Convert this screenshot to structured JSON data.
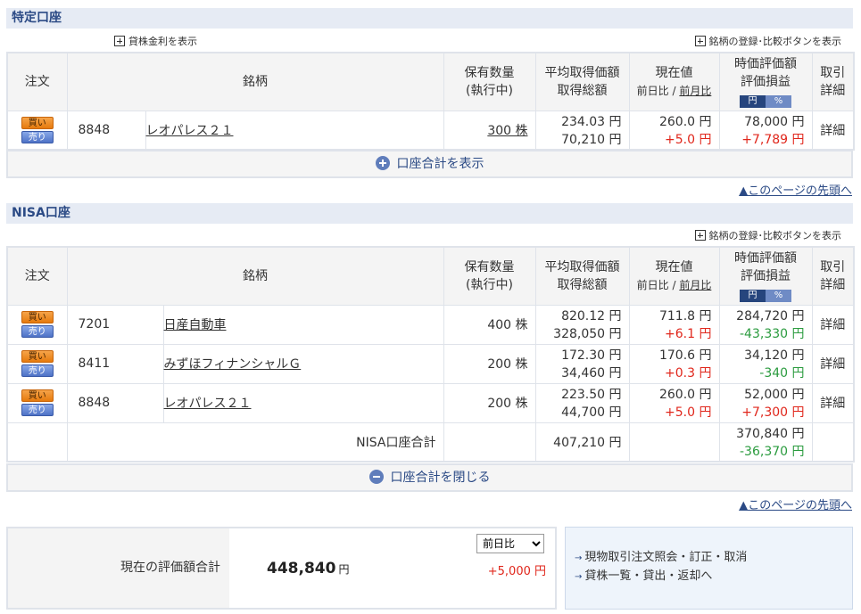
{
  "tokutei": {
    "title": "特定口座",
    "lending_toggle": "貸株金利を表示",
    "register_compare": "銘柄の登録･比較ボタンを表示",
    "headers": {
      "order": "注文",
      "issue": "銘柄",
      "qty": "保有数量",
      "qty_sub": "(執行中)",
      "avg_price": "平均取得価額",
      "acq_total": "取得総額",
      "current": "現在値",
      "day_change": "前日比",
      "sep": " / ",
      "month_change": "前月比",
      "market_value": "時価評価額",
      "pnl": "評価損益",
      "yen": "円",
      "pct": "%",
      "trade": "取引",
      "detail": "詳細"
    },
    "rows": [
      {
        "code": "8848",
        "name": "レオパレス２１",
        "qty": "300 株",
        "avg": "234.03 円",
        "acq": "70,210 円",
        "price": "260.0 円",
        "change": "+5.0 円",
        "value": "78,000 円",
        "pnl": "+7,789 円",
        "detail": "詳細"
      }
    ],
    "expand": "口座合計を表示",
    "page_top": "▲このページの先頭へ"
  },
  "nisa": {
    "title": "NISA口座",
    "register_compare": "銘柄の登録･比較ボタンを表示",
    "rows": [
      {
        "code": "7201",
        "name": "日産自動車",
        "qty": "400 株",
        "avg": "820.12 円",
        "acq": "328,050 円",
        "price": "711.8 円",
        "change": "+6.1 円",
        "value": "284,720 円",
        "pnl": "-43,330 円",
        "detail": "詳細"
      },
      {
        "code": "8411",
        "name": "みずほフィナンシャルＧ",
        "qty": "200 株",
        "avg": "172.30 円",
        "acq": "34,460 円",
        "price": "170.6 円",
        "change": "+0.3 円",
        "value": "34,120 円",
        "pnl": "-340 円",
        "detail": "詳細"
      },
      {
        "code": "8848",
        "name": "レオパレス２１",
        "qty": "200 株",
        "avg": "223.50 円",
        "acq": "44,700 円",
        "price": "260.0 円",
        "change": "+5.0 円",
        "value": "52,000 円",
        "pnl": "+7,300 円",
        "detail": "詳細"
      }
    ],
    "total_label": "NISA口座合計",
    "total_acq": "407,210 円",
    "total_value": "370,840 円",
    "total_pnl": "-36,370 円",
    "collapse": "口座合計を閉じる",
    "page_top": "▲このページの先頭へ"
  },
  "buttons": {
    "buy": "買い",
    "sell": "売り"
  },
  "summary": {
    "label": "現在の評価額合計",
    "total": "448,840",
    "unit": "円",
    "select_value": "前日比",
    "diff": "+5,000 円"
  },
  "links": [
    "現物取引注文照会・訂正・取消",
    "貸株一覧・貸出・返却へ"
  ],
  "colors": {
    "header_bg": "#e6ebf4",
    "accent": "#2b4a85",
    "up": "#e0261b",
    "down": "#2a9b3e"
  }
}
